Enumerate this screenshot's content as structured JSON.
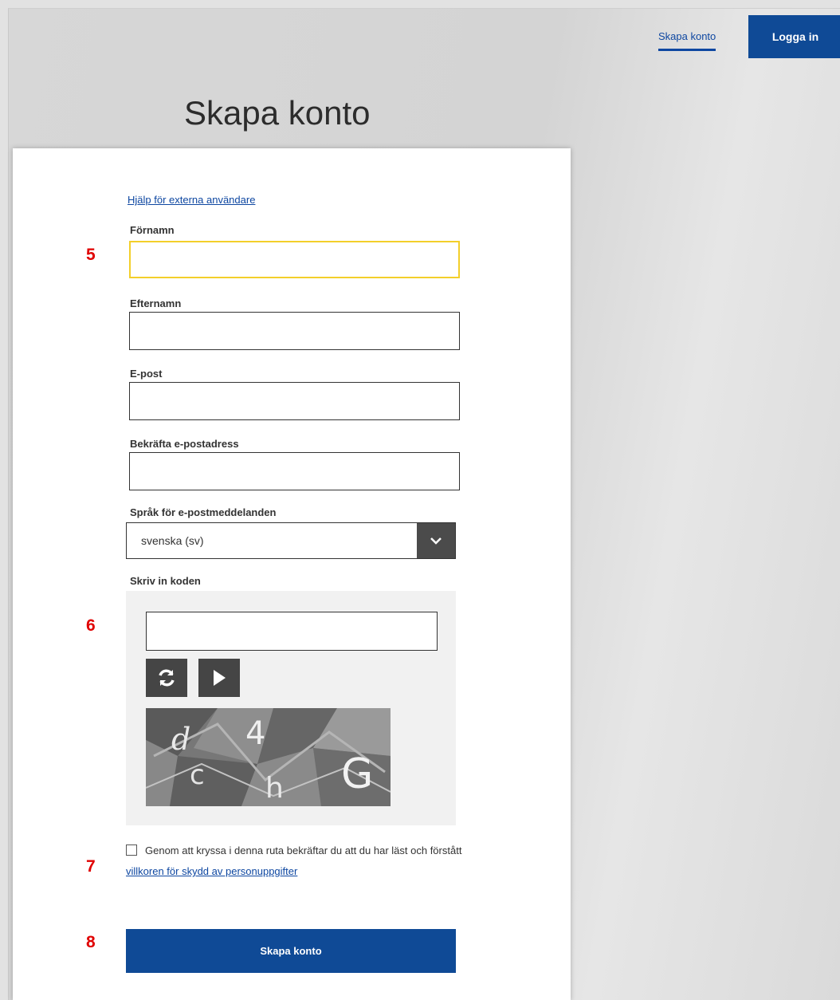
{
  "header": {
    "create_account_link": "Skapa konto",
    "login_button": "Logga in"
  },
  "page_title": "Skapa konto",
  "form": {
    "help_link": "Hjälp för externa användare",
    "first_name_label": "Förnamn",
    "last_name_label": "Efternamn",
    "email_label": "E-post",
    "confirm_email_label": "Bekräfta e-postadress",
    "language_label": "Språk för e-postmeddelanden",
    "language_value": "svenska (sv)",
    "captcha_label": "Skriv in koden",
    "consent_text": "Genom att kryssa i denna ruta bekräftar du att du har läst och förstått",
    "consent_link": "villkoren för skydd av personuppgifter",
    "submit_button": "Skapa konto"
  },
  "icons": {
    "dropdown": "chevron-down-icon",
    "refresh": "refresh-icon",
    "play": "play-icon"
  },
  "annotations": [
    "5",
    "6",
    "7",
    "8"
  ],
  "colors": {
    "primary": "#0f4a96",
    "focus": "#f3cf2a",
    "annotation": "#e00000"
  }
}
